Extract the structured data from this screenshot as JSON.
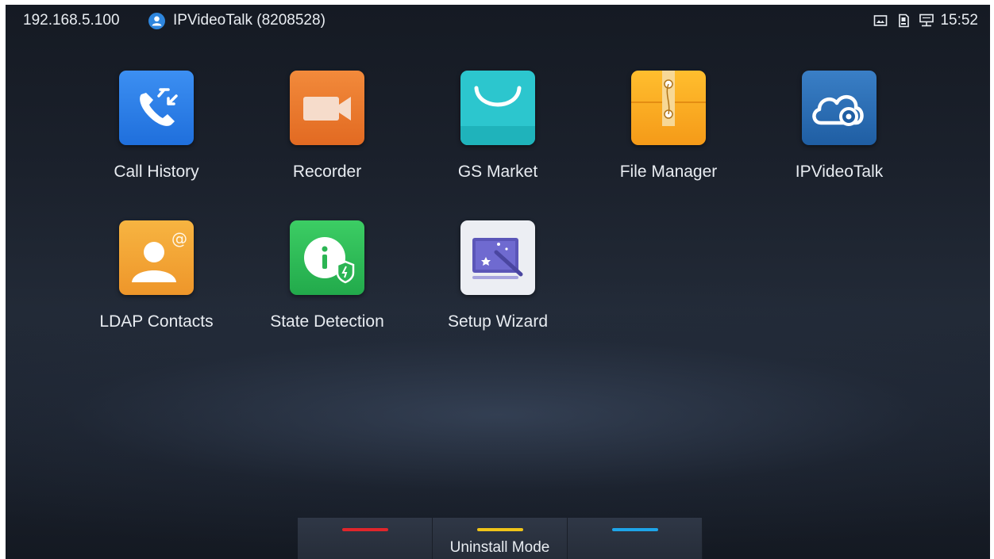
{
  "status_bar": {
    "ip_address": "192.168.5.100",
    "account_icon": "account-circle-icon",
    "account_label": "IPVideoTalk (8208528)",
    "system_icons": [
      "screen-icon",
      "sd-card-icon",
      "network-icon"
    ],
    "time": "15:52"
  },
  "apps": [
    {
      "label": "Call History",
      "icon": "call-history-icon",
      "color": "#2f80ed"
    },
    {
      "label": "Recorder",
      "icon": "recorder-icon",
      "color": "#ee7b2e"
    },
    {
      "label": "GS Market",
      "icon": "gs-market-icon",
      "color": "#27c2c9"
    },
    {
      "label": "File Manager",
      "icon": "file-manager-icon",
      "color": "#f5a623"
    },
    {
      "label": "IPVideoTalk",
      "icon": "ipvideotalk-icon",
      "color": "#2c6fb7"
    },
    {
      "label": "LDAP Contacts",
      "icon": "ldap-contacts-icon",
      "color": "#f2a33b"
    },
    {
      "label": "State Detection",
      "icon": "state-detection-icon",
      "color": "#2fbf5a"
    },
    {
      "label": "Setup Wizard",
      "icon": "setup-wizard-icon",
      "color": "#e9ecf2"
    }
  ],
  "softkeys": [
    {
      "label": "",
      "color": "#e0262b"
    },
    {
      "label": "Uninstall Mode",
      "color": "#f0c419"
    },
    {
      "label": "",
      "color": "#1ea5e9"
    }
  ]
}
